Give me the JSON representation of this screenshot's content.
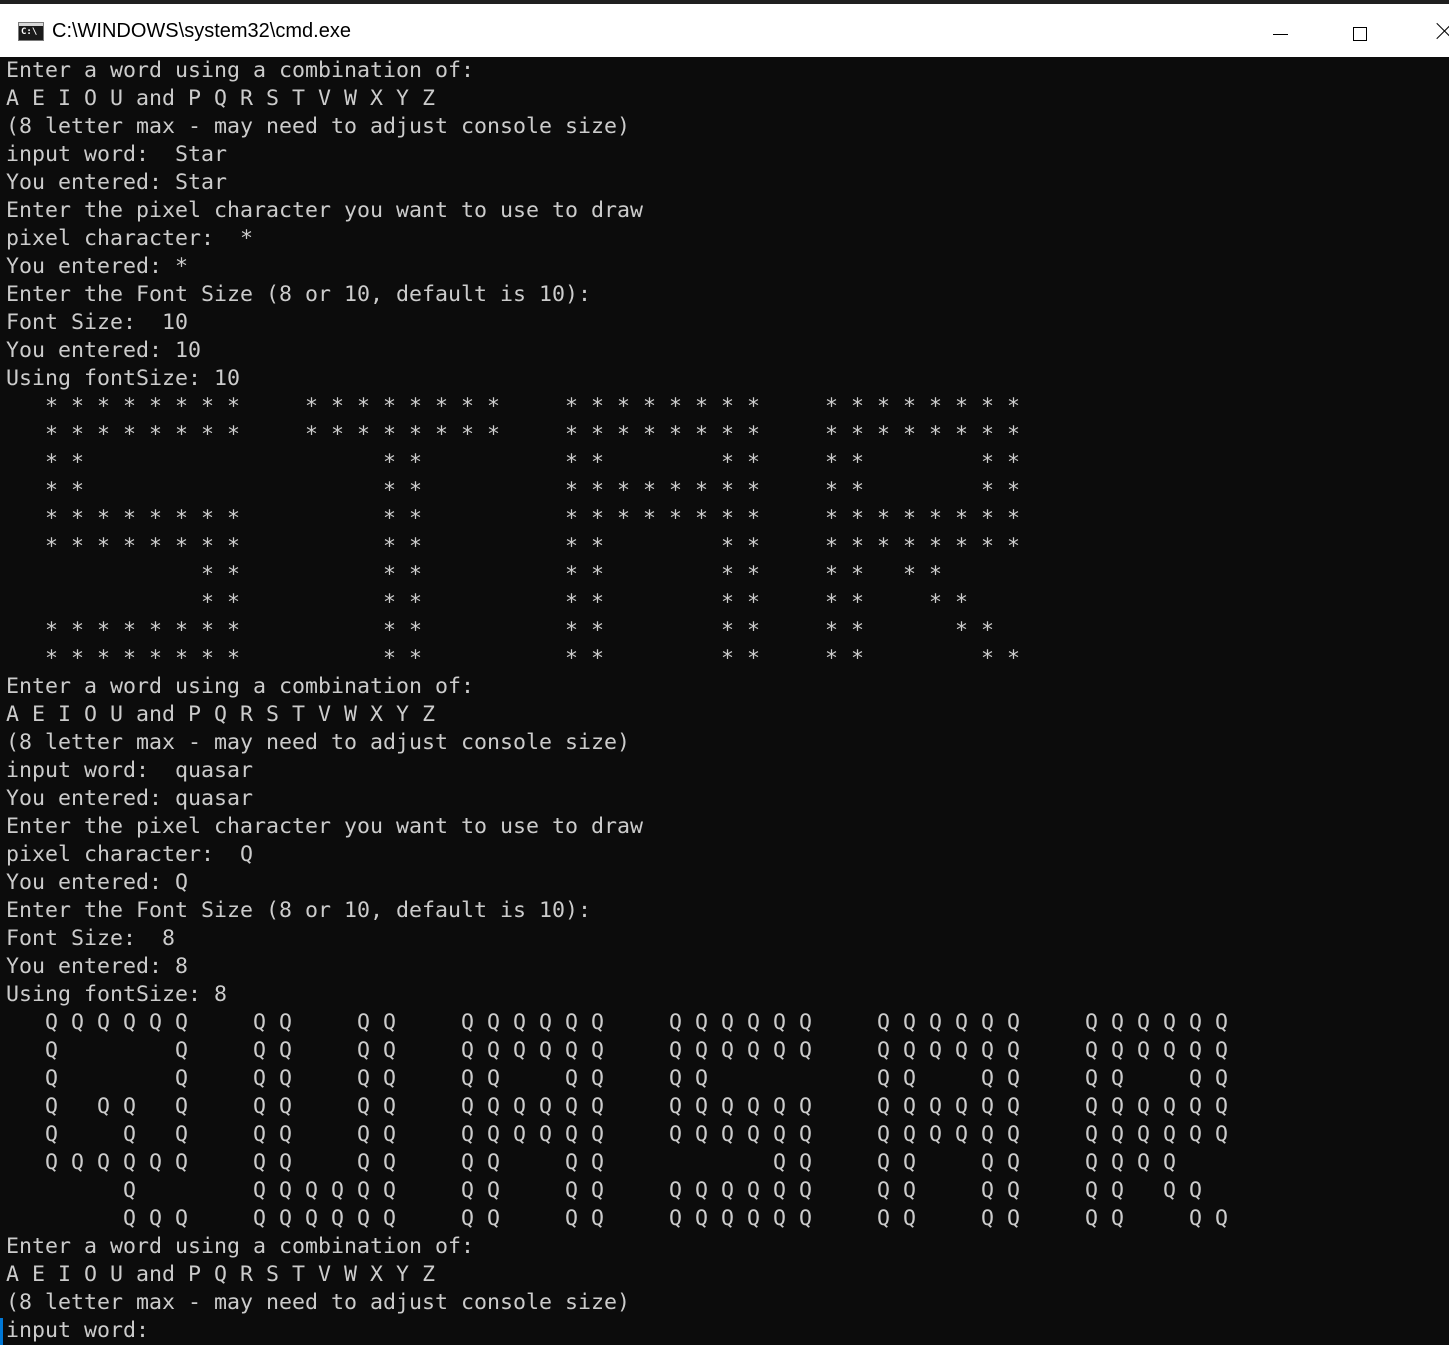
{
  "window": {
    "title": "C:\\WINDOWS\\system32\\cmd.exe",
    "icon": "cmd-icon",
    "icon_text": "C:\\",
    "controls": [
      "minimize-icon",
      "maximize-icon",
      "close-icon"
    ]
  },
  "colors": {
    "console_background": "#0c0c0c",
    "console_text": "#cccccc",
    "titlebar_background": "#ffffff",
    "accent": "#0078d7"
  },
  "console": {
    "lines": [
      "Enter a word using a combination of:",
      "A E I O U and P Q R S T V W X Y Z",
      "(8 letter max - may need to adjust console size)",
      "input word:  Star",
      "You entered: Star",
      "Enter the pixel character you want to use to draw",
      "pixel character:  *",
      "You entered: *",
      "Enter the Font Size (8 or 10, default is 10):",
      "Font Size:  10",
      "You entered: 10",
      "Using fontSize: 10",
      "   * * * * * * * *     * * * * * * * *     * * * * * * * *     * * * * * * * *",
      "   * * * * * * * *     * * * * * * * *     * * * * * * * *     * * * * * * * *",
      "   * *                       * *           * *         * *     * *         * *",
      "   * *                       * *           * * * * * * * *     * *         * *",
      "   * * * * * * * *           * *           * * * * * * * *     * * * * * * * *",
      "   * * * * * * * *           * *           * *         * *     * * * * * * * *",
      "               * *           * *           * *         * *     * *   * *",
      "               * *           * *           * *         * *     * *     * *",
      "   * * * * * * * *           * *           * *         * *     * *       * *",
      "   * * * * * * * *           * *           * *         * *     * *         * *",
      "Enter a word using a combination of:",
      "A E I O U and P Q R S T V W X Y Z",
      "(8 letter max - may need to adjust console size)",
      "input word:  quasar",
      "You entered: quasar",
      "Enter the pixel character you want to use to draw",
      "pixel character:  Q",
      "You entered: Q",
      "Enter the Font Size (8 or 10, default is 10):",
      "Font Size:  8",
      "You entered: 8",
      "Using fontSize: 8",
      "   Q Q Q Q Q Q     Q Q     Q Q     Q Q Q Q Q Q     Q Q Q Q Q Q     Q Q Q Q Q Q     Q Q Q Q Q Q",
      "   Q         Q     Q Q     Q Q     Q Q Q Q Q Q     Q Q Q Q Q Q     Q Q Q Q Q Q     Q Q Q Q Q Q",
      "   Q         Q     Q Q     Q Q     Q Q     Q Q     Q Q             Q Q     Q Q     Q Q     Q Q",
      "   Q   Q Q   Q     Q Q     Q Q     Q Q Q Q Q Q     Q Q Q Q Q Q     Q Q Q Q Q Q     Q Q Q Q Q Q",
      "   Q     Q   Q     Q Q     Q Q     Q Q Q Q Q Q     Q Q Q Q Q Q     Q Q Q Q Q Q     Q Q Q Q Q Q",
      "   Q Q Q Q Q Q     Q Q     Q Q     Q Q     Q Q             Q Q     Q Q     Q Q     Q Q Q Q",
      "         Q         Q Q Q Q Q Q     Q Q     Q Q     Q Q Q Q Q Q     Q Q     Q Q     Q Q   Q Q",
      "         Q Q Q     Q Q Q Q Q Q     Q Q     Q Q     Q Q Q Q Q Q     Q Q     Q Q     Q Q     Q Q",
      "Enter a word using a combination of:",
      "A E I O U and P Q R S T V W X Y Z",
      "(8 letter max - may need to adjust console size)",
      "input word:"
    ]
  }
}
